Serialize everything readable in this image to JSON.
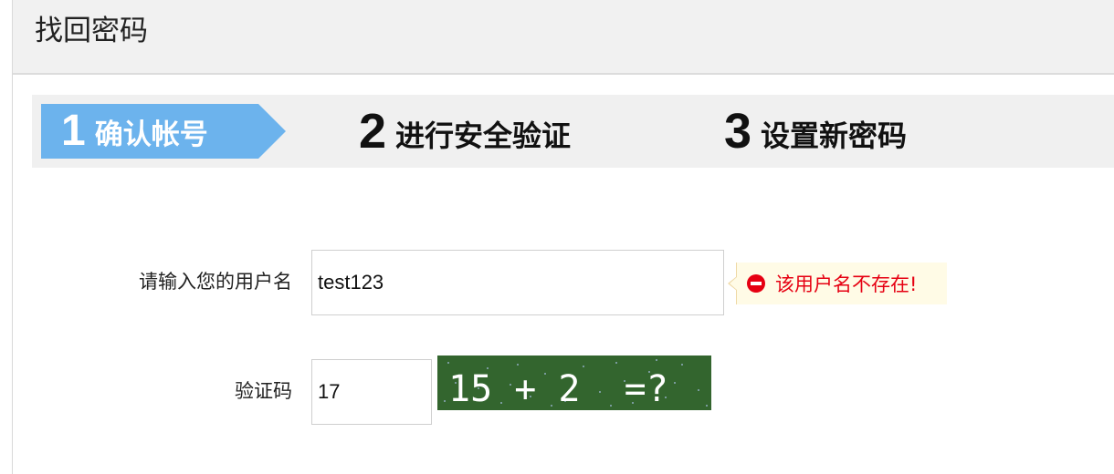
{
  "header": {
    "title": "找回密码"
  },
  "steps": [
    {
      "number": "1",
      "label": "确认帐号",
      "active": true
    },
    {
      "number": "2",
      "label": "进行安全验证",
      "active": false
    },
    {
      "number": "3",
      "label": "设置新密码",
      "active": false
    }
  ],
  "form": {
    "username": {
      "label": "请输入您的用户名",
      "value": "test123",
      "error": "该用户名不存在!"
    },
    "captcha": {
      "label": "验证码",
      "value": "17",
      "image_text": "15 + 2  =?"
    }
  },
  "colors": {
    "active_step": "#6cb3ed",
    "error_text": "#e60012",
    "captcha_bg": "#33652e"
  },
  "icons": {
    "error": "no-entry-icon"
  }
}
